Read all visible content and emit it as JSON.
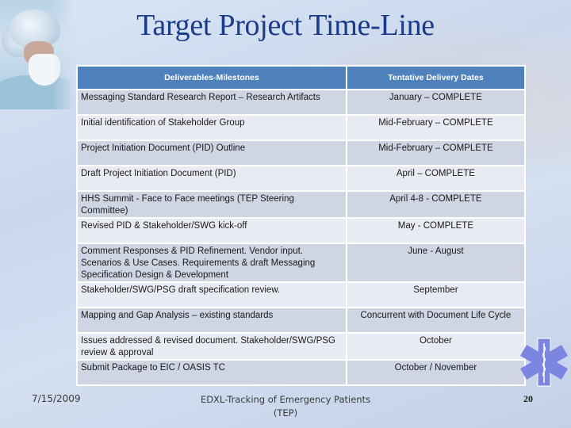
{
  "slide": {
    "title": "Target Project Time-Line"
  },
  "table": {
    "headers": [
      "Deliverables-Milestones",
      "Tentative Delivery Dates"
    ],
    "rows": [
      {
        "deliverable": "Messaging Standard Research Report – Research Artifacts",
        "date": "January – COMPLETE"
      },
      {
        "deliverable": "Initial identification of Stakeholder Group",
        "date": "Mid-February – COMPLETE"
      },
      {
        "deliverable": "Project Initiation Document (PID) Outline",
        "date": "Mid-February – COMPLETE"
      },
      {
        "deliverable": "Draft Project Initiation Document (PID)",
        "date": "April – COMPLETE"
      },
      {
        "deliverable": "HHS Summit - Face to Face meetings (TEP Steering Committee)",
        "date": "April 4-8 - COMPLETE"
      },
      {
        "deliverable": "Revised PID & Stakeholder/SWG kick-off",
        "date": "May  - COMPLETE"
      },
      {
        "deliverable": "Comment Responses & PID Refinement. Vendor input. Scenarios & Use Cases.  Requirements & draft Messaging Specification Design & Development",
        "date": "June - August"
      },
      {
        "deliverable": "Stakeholder/SWG/PSG draft specification review.",
        "date": "September"
      },
      {
        "deliverable": "Mapping and Gap Analysis – existing standards",
        "date": "Concurrent with Document Life Cycle"
      },
      {
        "deliverable": "Issues addressed & revised document. Stakeholder/SWG/PSG review & approval",
        "date": "October"
      },
      {
        "deliverable": "Submit Package to EIC / OASIS TC",
        "date": "October / November"
      }
    ]
  },
  "footer": {
    "date": "7/15/2009",
    "title_line1": "EDXL-Tracking of Emergency Patients",
    "title_line2": "(TEP)",
    "page_number": "20"
  },
  "icons": {
    "decor_photo": "surgeon-photo",
    "logo": "star-of-life-icon"
  },
  "colors": {
    "title": "#1a3a8a",
    "header_bg": "#4f81bd",
    "row_dark": "#cfd5e3",
    "row_light": "#e8ebf2",
    "star_of_life": "#7b86e0"
  }
}
